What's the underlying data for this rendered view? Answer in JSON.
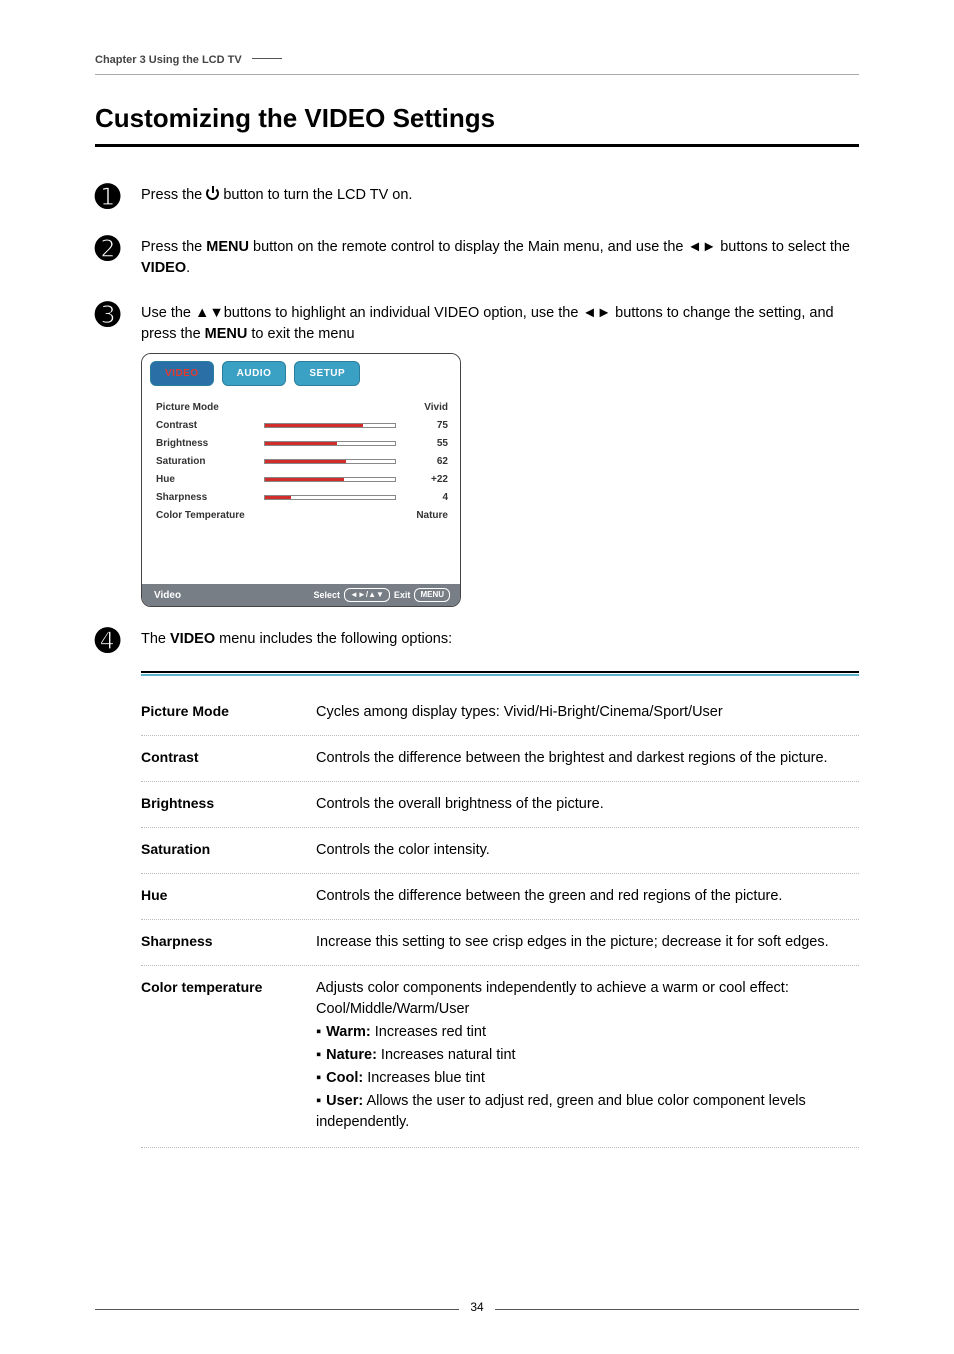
{
  "chapter": "Chapter 3 Using the LCD TV",
  "heading": "Customizing the VIDEO Settings",
  "steps": {
    "s1": {
      "num": "➊",
      "prefix": "Press the ",
      "suffix": " button to turn the LCD TV on."
    },
    "s2": {
      "num": "➋",
      "t1": "Press the ",
      "bold1": "MENU",
      "t2": " button on the remote control to display the Main menu, and use the ◄► buttons to select the ",
      "bold2": "VIDEO",
      "t3": "."
    },
    "s3": {
      "num": "➌",
      "t1": "Use the ▲▼buttons to highlight an individual VIDEO option, use the ◄► buttons to change the setting, and press the ",
      "bold1": "MENU",
      "t2": " to exit the menu"
    },
    "s4": {
      "num": "➍",
      "t1": "The ",
      "bold1": "VIDEO",
      "t2": " menu includes the following options:"
    }
  },
  "osd": {
    "tabs": {
      "video": "VIDEO",
      "audio": "AUDIO",
      "setup": "SETUP"
    },
    "items": {
      "picture_mode": {
        "label": "Picture Mode",
        "value": "Vivid"
      },
      "contrast": {
        "label": "Contrast",
        "value": "75",
        "fill": 75
      },
      "brightness": {
        "label": "Brightness",
        "value": "55",
        "fill": 55
      },
      "saturation": {
        "label": "Saturation",
        "value": "62",
        "fill": 62
      },
      "hue": {
        "label": "Hue",
        "value": "+22",
        "fill": 61
      },
      "sharpness": {
        "label": "Sharpness",
        "value": "4",
        "fill": 20
      },
      "color_temp": {
        "label": "Color Temperature",
        "value": "Nature"
      }
    },
    "footer": {
      "title": "Video",
      "select": "Select",
      "arrowbox": "◄►/▲▼",
      "exit": "Exit",
      "menu": "MENU"
    }
  },
  "options": {
    "picture_mode": {
      "label": "Picture Mode",
      "desc": "Cycles among display types: Vivid/Hi-Bright/Cinema/Sport/User"
    },
    "contrast": {
      "label": "Contrast",
      "desc": "Controls the difference between the brightest and darkest regions of the picture."
    },
    "brightness": {
      "label": "Brightness",
      "desc": "Controls the overall brightness of the picture."
    },
    "saturation": {
      "label": "Saturation",
      "desc": "Controls the color intensity."
    },
    "hue": {
      "label": "Hue",
      "desc": "Controls the difference between the green and red regions of the picture."
    },
    "sharpness": {
      "label": "Sharpness",
      "desc": "Increase this setting to see crisp edges in the picture; decrease it for soft edges."
    },
    "ct": {
      "label": "Color temperature",
      "intro": "Adjusts color components independently to achieve a warm or cool effect: Cool/Middle/Warm/User",
      "warm_b": "Warm:",
      "warm_t": " Increases red tint",
      "nature_b": "Nature:",
      "nature_t": " Increases natural tint",
      "cool_b": "Cool:",
      "cool_t": " Increases blue tint",
      "user_b": "User:",
      "user_t": " Allows the user to adjust red, green and blue color component levels independently."
    }
  },
  "pageno": "34"
}
